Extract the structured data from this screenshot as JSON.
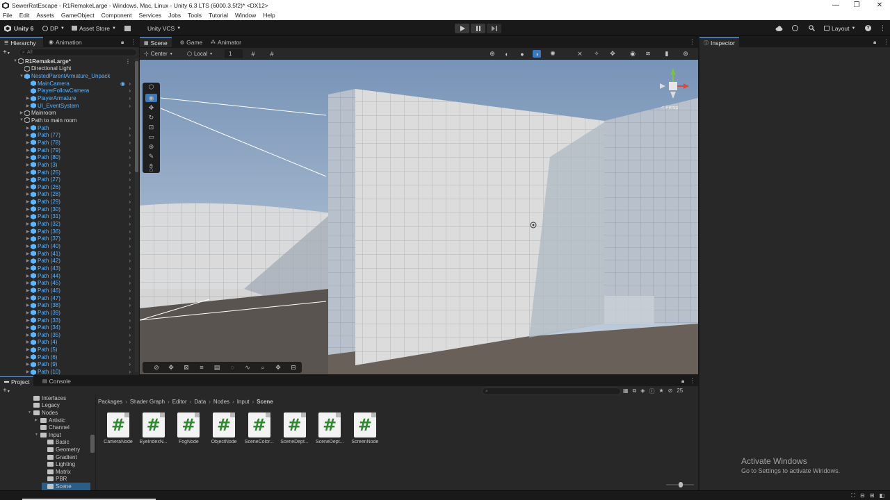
{
  "window": {
    "title": "SewerRatEscape - R1RemakeLarge - Windows, Mac, Linux - Unity 6.3 LTS (6000.3.5f2)* <DX12>",
    "minimize": "—",
    "maximize": "❐",
    "close": "✕"
  },
  "menu": [
    "File",
    "Edit",
    "Assets",
    "GameObject",
    "Component",
    "Services",
    "Jobs",
    "Tools",
    "Tutorial",
    "Window",
    "Help"
  ],
  "toolbar": {
    "unity_label": "Unity 6",
    "account": "DP",
    "asset_store": "Asset Store",
    "vcs": "Unity VCS",
    "layout": "Layout"
  },
  "hierarchy": {
    "tab_label": "Hierarchy",
    "tab2_label": "Animation",
    "search_placeholder": "All",
    "rows": [
      {
        "name": "R1RemakeLarge*",
        "indent": 0,
        "type": "scene",
        "color": "white",
        "expanded": true,
        "chev": false
      },
      {
        "name": "Directional Light",
        "indent": 1,
        "type": "go",
        "color": "white",
        "expanded": null,
        "chev": false
      },
      {
        "name": "NestedParentArmature_Unpack",
        "indent": 1,
        "type": "prefab",
        "color": "blue",
        "expanded": true,
        "chev": false
      },
      {
        "name": "MainCamera",
        "indent": 2,
        "type": "prefab",
        "color": "blue",
        "expanded": null,
        "chev": true
      },
      {
        "name": "PlayerFollowCamera",
        "indent": 2,
        "type": "prefab",
        "color": "blue",
        "expanded": null,
        "chev": true
      },
      {
        "name": "PlayerArmature",
        "indent": 2,
        "type": "prefab",
        "color": "blue",
        "expanded": false,
        "chev": true
      },
      {
        "name": "UI_EventSystem",
        "indent": 2,
        "type": "prefab",
        "color": "blue",
        "expanded": false,
        "chev": true
      },
      {
        "name": "Mainroom",
        "indent": 1,
        "type": "go",
        "color": "white",
        "expanded": false,
        "chev": false
      },
      {
        "name": "Path to main room",
        "indent": 1,
        "type": "go",
        "color": "white",
        "expanded": true,
        "chev": false
      },
      {
        "name": "Path",
        "indent": 2,
        "type": "prefab",
        "color": "blue",
        "expanded": false,
        "chev": true
      },
      {
        "name": "Path (77)",
        "indent": 2,
        "type": "prefab",
        "color": "blue",
        "expanded": false,
        "chev": true
      },
      {
        "name": "Path (78)",
        "indent": 2,
        "type": "prefab",
        "color": "blue",
        "expanded": false,
        "chev": true
      },
      {
        "name": "Path (79)",
        "indent": 2,
        "type": "prefab",
        "color": "blue",
        "expanded": false,
        "chev": true
      },
      {
        "name": "Path (80)",
        "indent": 2,
        "type": "prefab",
        "color": "blue",
        "expanded": false,
        "chev": true
      },
      {
        "name": "Path (3)",
        "indent": 2,
        "type": "prefab",
        "color": "blue",
        "expanded": false,
        "chev": true
      },
      {
        "name": "Path (25)",
        "indent": 2,
        "type": "prefab",
        "color": "blue",
        "expanded": false,
        "chev": true
      },
      {
        "name": "Path (27)",
        "indent": 2,
        "type": "prefab",
        "color": "blue",
        "expanded": false,
        "chev": true
      },
      {
        "name": "Path (26)",
        "indent": 2,
        "type": "prefab",
        "color": "blue",
        "expanded": false,
        "chev": true
      },
      {
        "name": "Path (28)",
        "indent": 2,
        "type": "prefab",
        "color": "blue",
        "expanded": false,
        "chev": true
      },
      {
        "name": "Path (29)",
        "indent": 2,
        "type": "prefab",
        "color": "blue",
        "expanded": false,
        "chev": true
      },
      {
        "name": "Path (30)",
        "indent": 2,
        "type": "prefab",
        "color": "blue",
        "expanded": false,
        "chev": true
      },
      {
        "name": "Path (31)",
        "indent": 2,
        "type": "prefab",
        "color": "blue",
        "expanded": false,
        "chev": true
      },
      {
        "name": "Path (32)",
        "indent": 2,
        "type": "prefab",
        "color": "blue",
        "expanded": false,
        "chev": true
      },
      {
        "name": "Path (36)",
        "indent": 2,
        "type": "prefab",
        "color": "blue",
        "expanded": false,
        "chev": true
      },
      {
        "name": "Path (37)",
        "indent": 2,
        "type": "prefab",
        "color": "blue",
        "expanded": false,
        "chev": true
      },
      {
        "name": "Path (40)",
        "indent": 2,
        "type": "prefab",
        "color": "blue",
        "expanded": false,
        "chev": true
      },
      {
        "name": "Path (41)",
        "indent": 2,
        "type": "prefab",
        "color": "blue",
        "expanded": false,
        "chev": true
      },
      {
        "name": "Path (42)",
        "indent": 2,
        "type": "prefab",
        "color": "blue",
        "expanded": false,
        "chev": true
      },
      {
        "name": "Path (43)",
        "indent": 2,
        "type": "prefab",
        "color": "blue",
        "expanded": false,
        "chev": true
      },
      {
        "name": "Path (44)",
        "indent": 2,
        "type": "prefab",
        "color": "blue",
        "expanded": false,
        "chev": true
      },
      {
        "name": "Path (45)",
        "indent": 2,
        "type": "prefab",
        "color": "blue",
        "expanded": false,
        "chev": true
      },
      {
        "name": "Path (46)",
        "indent": 2,
        "type": "prefab",
        "color": "blue",
        "expanded": false,
        "chev": true
      },
      {
        "name": "Path (47)",
        "indent": 2,
        "type": "prefab",
        "color": "blue",
        "expanded": false,
        "chev": true
      },
      {
        "name": "Path (38)",
        "indent": 2,
        "type": "prefab",
        "color": "blue",
        "expanded": false,
        "chev": true
      },
      {
        "name": "Path (39)",
        "indent": 2,
        "type": "prefab",
        "color": "blue",
        "expanded": false,
        "chev": true
      },
      {
        "name": "Path (33)",
        "indent": 2,
        "type": "prefab",
        "color": "blue",
        "expanded": false,
        "chev": true
      },
      {
        "name": "Path (34)",
        "indent": 2,
        "type": "prefab",
        "color": "blue",
        "expanded": false,
        "chev": true
      },
      {
        "name": "Path (35)",
        "indent": 2,
        "type": "prefab",
        "color": "blue",
        "expanded": false,
        "chev": true
      },
      {
        "name": "Path (4)",
        "indent": 2,
        "type": "prefab",
        "color": "blue",
        "expanded": false,
        "chev": true
      },
      {
        "name": "Path (5)",
        "indent": 2,
        "type": "prefab",
        "color": "blue",
        "expanded": false,
        "chev": true
      },
      {
        "name": "Path (6)",
        "indent": 2,
        "type": "prefab",
        "color": "blue",
        "expanded": false,
        "chev": true
      },
      {
        "name": "Path (9)",
        "indent": 2,
        "type": "prefab",
        "color": "blue",
        "expanded": false,
        "chev": true
      },
      {
        "name": "Path (10)",
        "indent": 2,
        "type": "prefab",
        "color": "blue",
        "expanded": false,
        "chev": true
      }
    ]
  },
  "scene_view": {
    "tabs": [
      "Scene",
      "Game",
      "Animator"
    ],
    "pivot": "Center",
    "space": "Local",
    "grid_value": "1",
    "projection": "< Persp"
  },
  "inspector": {
    "tab_label": "Inspector"
  },
  "project": {
    "tab_label": "Project",
    "console_label": "Console",
    "item_count": "25",
    "breadcrumb": [
      "Packages",
      "Shader Graph",
      "Editor",
      "Data",
      "Nodes",
      "Input",
      "Scene"
    ],
    "tree": [
      {
        "name": "Interfaces",
        "indent": 3,
        "expanded": null
      },
      {
        "name": "Legacy",
        "indent": 3,
        "expanded": null
      },
      {
        "name": "Nodes",
        "indent": 3,
        "expanded": true
      },
      {
        "name": "Artistic",
        "indent": 4,
        "expanded": false
      },
      {
        "name": "Channel",
        "indent": 4,
        "expanded": null
      },
      {
        "name": "Input",
        "indent": 4,
        "expanded": true
      },
      {
        "name": "Basic",
        "indent": 5,
        "expanded": null
      },
      {
        "name": "Geometry",
        "indent": 5,
        "expanded": null
      },
      {
        "name": "Gradient",
        "indent": 5,
        "expanded": null
      },
      {
        "name": "Lighting",
        "indent": 5,
        "expanded": null
      },
      {
        "name": "Matrix",
        "indent": 5,
        "expanded": null
      },
      {
        "name": "PBR",
        "indent": 5,
        "expanded": null
      },
      {
        "name": "Scene",
        "indent": 5,
        "expanded": null
      }
    ],
    "assets": [
      "CameraNode",
      "EyeIndexN...",
      "FogNode",
      "ObjectNode",
      "SceneColor...",
      "SceneDept...",
      "SceneDept...",
      "ScreenNode"
    ]
  },
  "watermark": {
    "line1": "Activate Windows",
    "line2": "Go to Settings to activate Windows."
  },
  "colors": {
    "accent": "#3a79bb",
    "prefab_blue": "#5fb4ff",
    "panel_bg": "#282828",
    "toolbar_bg": "#191919"
  }
}
